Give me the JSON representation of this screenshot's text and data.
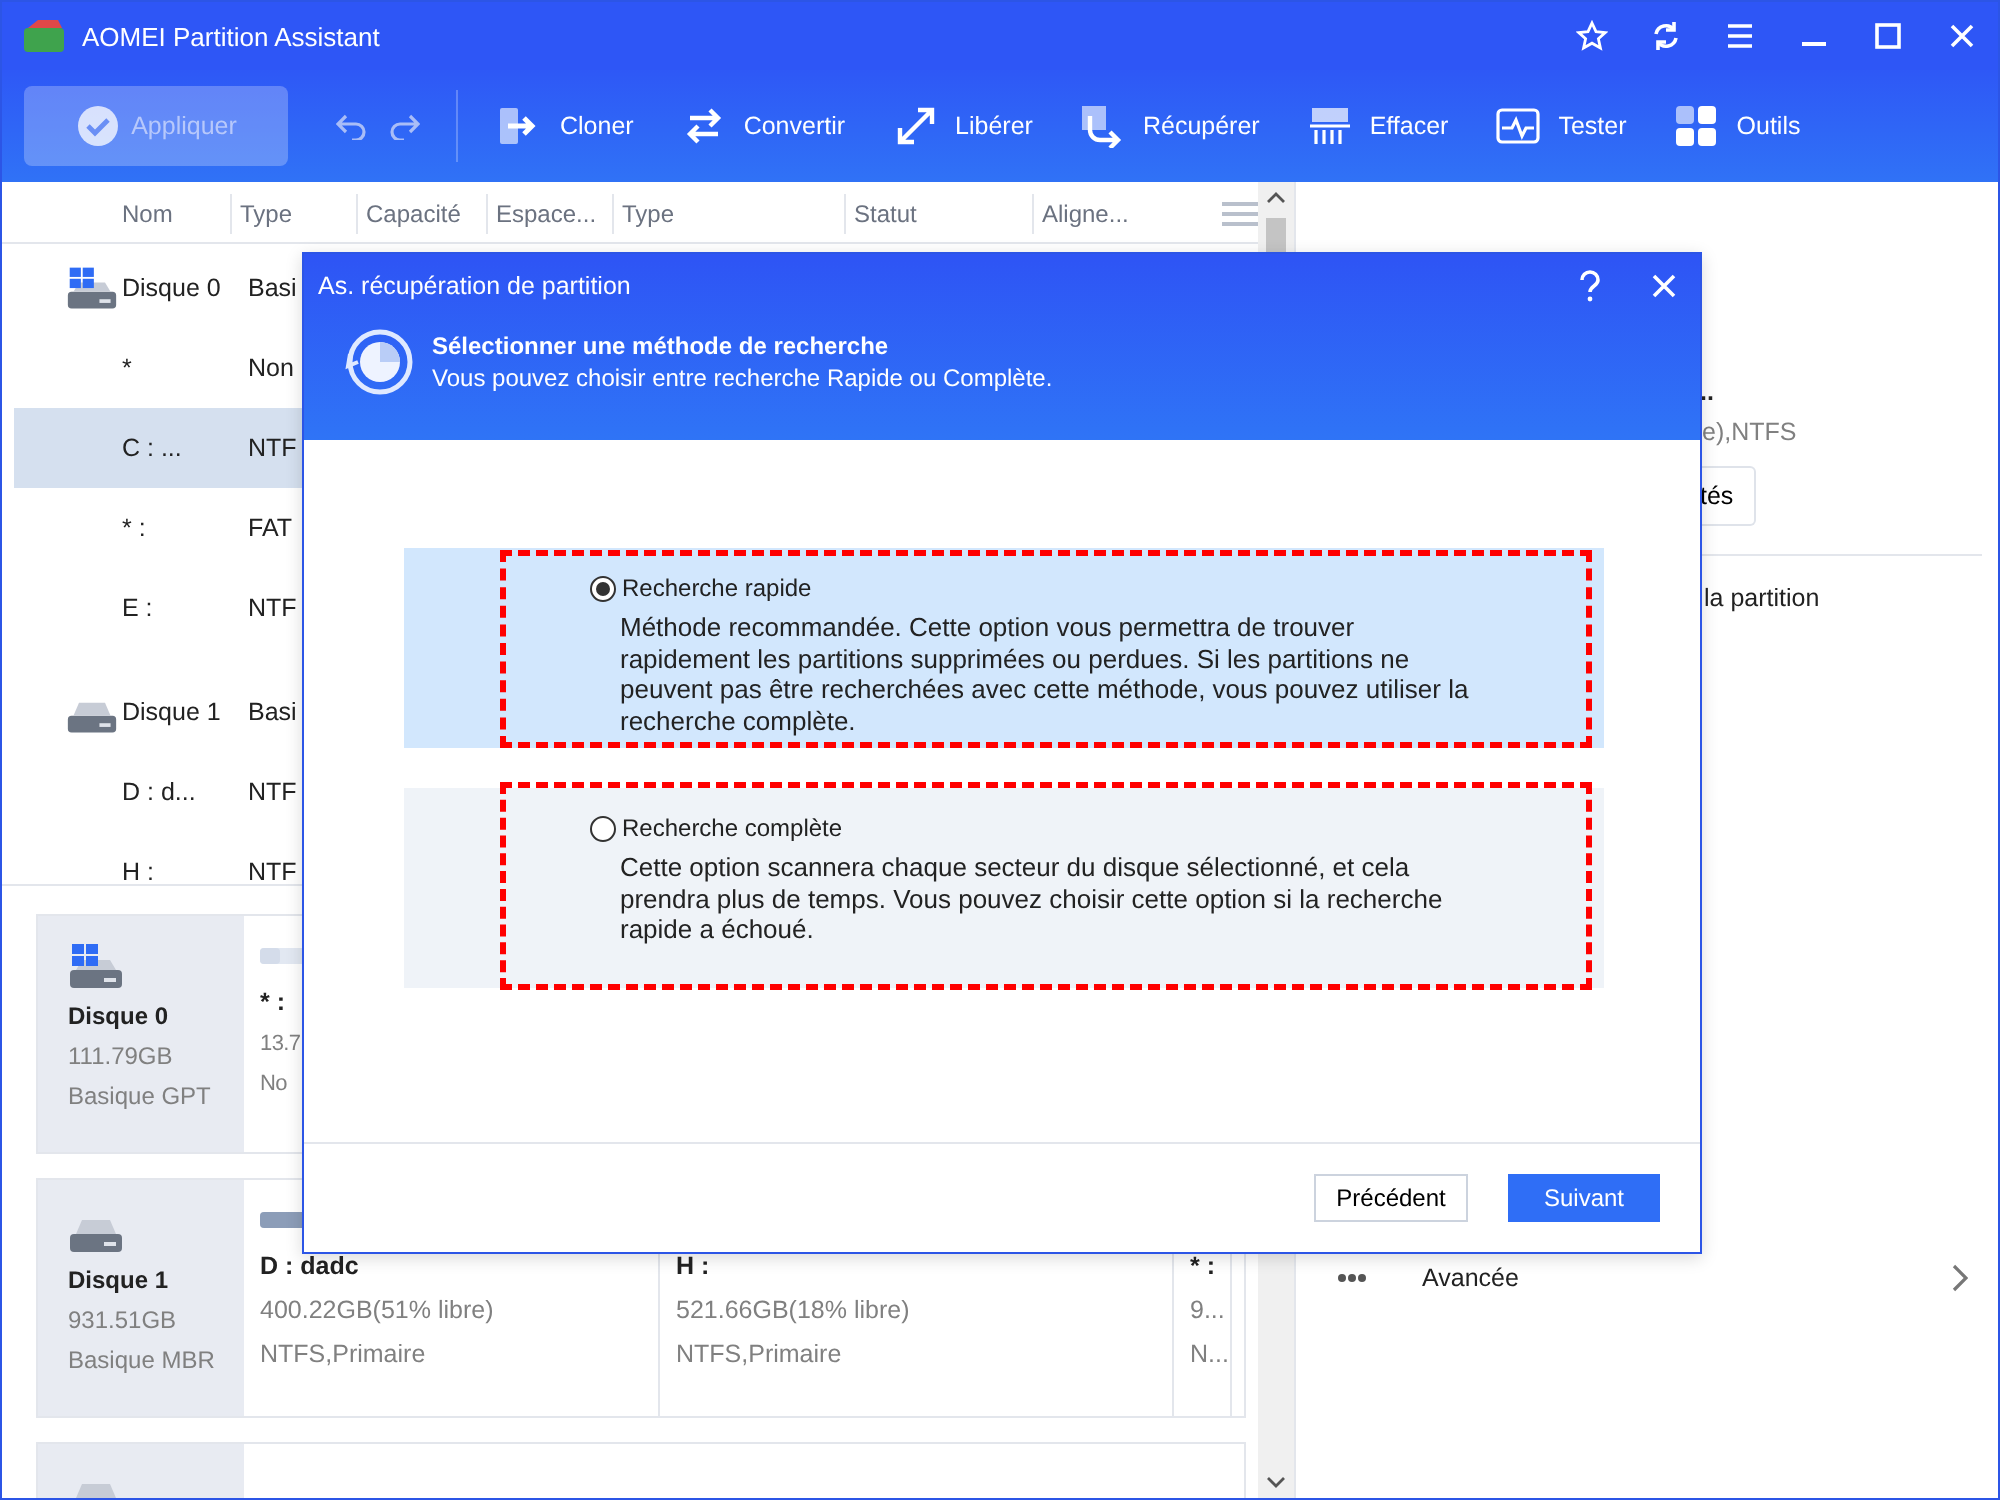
{
  "window": {
    "title": "AOMEI Partition Assistant"
  },
  "toolbar": {
    "apply": {
      "label": "Appliquer",
      "disabled": true
    },
    "tools": [
      {
        "label": "Cloner",
        "kind": "clone"
      },
      {
        "label": "Convertir",
        "kind": "convert"
      },
      {
        "label": "Libérer",
        "kind": "resize"
      },
      {
        "label": "Récupérer",
        "kind": "recover"
      },
      {
        "label": "Effacer",
        "kind": "wipe"
      },
      {
        "label": "Tester",
        "kind": "test"
      },
      {
        "label": "Outils",
        "kind": "tools"
      }
    ]
  },
  "table": {
    "columns": [
      "Nom",
      "Type",
      "Capacité",
      "Espace...",
      "Type",
      "Statut",
      "Aligne..."
    ],
    "rows": [
      {
        "kind": "system-disk",
        "name": "Disque 0",
        "type": "Basi",
        "selected": false
      },
      {
        "kind": "partition",
        "name": "*",
        "type": "Non",
        "selected": false
      },
      {
        "kind": "partition",
        "name": "C : ...",
        "type": "NTF",
        "selected": true
      },
      {
        "kind": "partition",
        "name": "* :",
        "type": "FAT",
        "selected": false
      },
      {
        "kind": "partition",
        "name": "E :",
        "type": "NTF",
        "selected": false
      },
      {
        "kind": "disk",
        "name": "Disque 1",
        "type": "Basi",
        "selected": false
      },
      {
        "kind": "partition",
        "name": "D : d...",
        "type": "NTF",
        "selected": false
      },
      {
        "kind": "partition",
        "name": "H :",
        "type": "NTF",
        "selected": false
      }
    ]
  },
  "disk_cards": [
    {
      "kind": "system-disk",
      "name": "Disque 0",
      "size": "111.79GB",
      "style": "Basique GPT",
      "partitions": [
        {
          "name": "* :",
          "size": "13.7",
          "fs": "No",
          "level": 0.05
        }
      ]
    },
    {
      "kind": "disk",
      "name": "Disque 1",
      "size": "931.51GB",
      "style": "Basique MBR",
      "partitions": [
        {
          "name": "D : dadc",
          "size": "400.22GB(51% libre)",
          "fs": "NTFS,Primaire",
          "level": 0.49
        },
        {
          "name": "H :",
          "size": "521.66GB(18% libre)",
          "fs": "NTFS,Primaire",
          "level": 0.82
        },
        {
          "name": "* :",
          "size": "9...",
          "fs": "N...",
          "level": 0.5
        }
      ]
    },
    {
      "kind": "disk"
    }
  ],
  "right_panel": {
    "name": "..",
    "detail": "e),NTFS",
    "button": "tés",
    "action": "la partition",
    "more": "Avancée"
  },
  "dialog": {
    "title": "As. récupération de partition",
    "heading": "Sélectionner une méthode de recherche",
    "subheading": "Vous pouvez choisir entre recherche Rapide ou Complète.",
    "options": [
      {
        "label": "Recherche rapide",
        "description": "Méthode recommandée. Cette option vous permettra de trouver rapidement les partitions supprimées ou perdues. Si les partitions ne peuvent pas être recherchées avec cette méthode, vous pouvez utiliser la recherche complète.",
        "selected": true
      },
      {
        "label": "Recherche complète",
        "description": "Cette option scannera chaque secteur du disque sélectionné, et cela prendra plus de temps. Vous pouvez choisir cette option si la recherche rapide a échoué.",
        "selected": false
      }
    ],
    "buttons": [
      {
        "label": "Précédent",
        "kind": "secondary"
      },
      {
        "label": "Suivant",
        "kind": "primary"
      }
    ]
  }
}
